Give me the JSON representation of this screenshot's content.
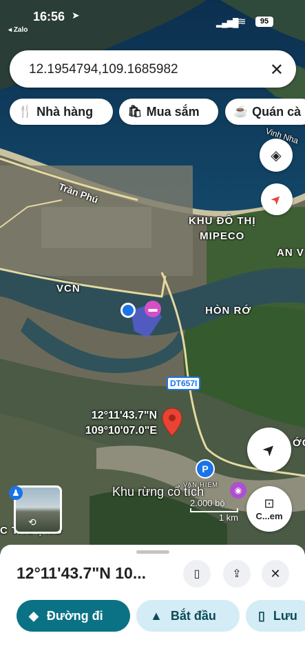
{
  "status": {
    "time": "16:56",
    "back_app": "Zalo",
    "battery": "95"
  },
  "search": {
    "query": "12.1954794,109.1685982"
  },
  "chips": [
    {
      "label": "Nhà hàng",
      "icon": "restaurant-icon"
    },
    {
      "label": "Mua sắm",
      "icon": "shopping-bag-icon"
    },
    {
      "label": "Quán cà",
      "icon": "coffee-icon"
    }
  ],
  "map_labels": {
    "street": "Trần Phú",
    "bay": "Vinh Nha",
    "district": "KHU ĐÔ THỊ\nMIPECO",
    "an_v": "AN V",
    "vcn": "VCN",
    "hon_ro": "HÒN RỚ",
    "route": "DT657I",
    "park": "Khu rừng cổ tích",
    "village": "C THƯỢNG",
    "odd": "ỚC",
    "van_hiem": "VAN HIEM"
  },
  "pin": {
    "lat": "12°11'43.7\"N",
    "lon": "109°10'07.0\"E"
  },
  "scale": {
    "top": "2.000 bộ",
    "bottom": "1 km"
  },
  "camera_label": "C...em",
  "place": {
    "title": "12°11'43.7\"N 10..."
  },
  "actions": {
    "directions": "Đường đi",
    "start": "Bắt đầu",
    "save": "Lưu"
  },
  "colors": {
    "accent": "#0b7285",
    "pin": "#ea4335",
    "light_chip": "#d3ecf5"
  }
}
